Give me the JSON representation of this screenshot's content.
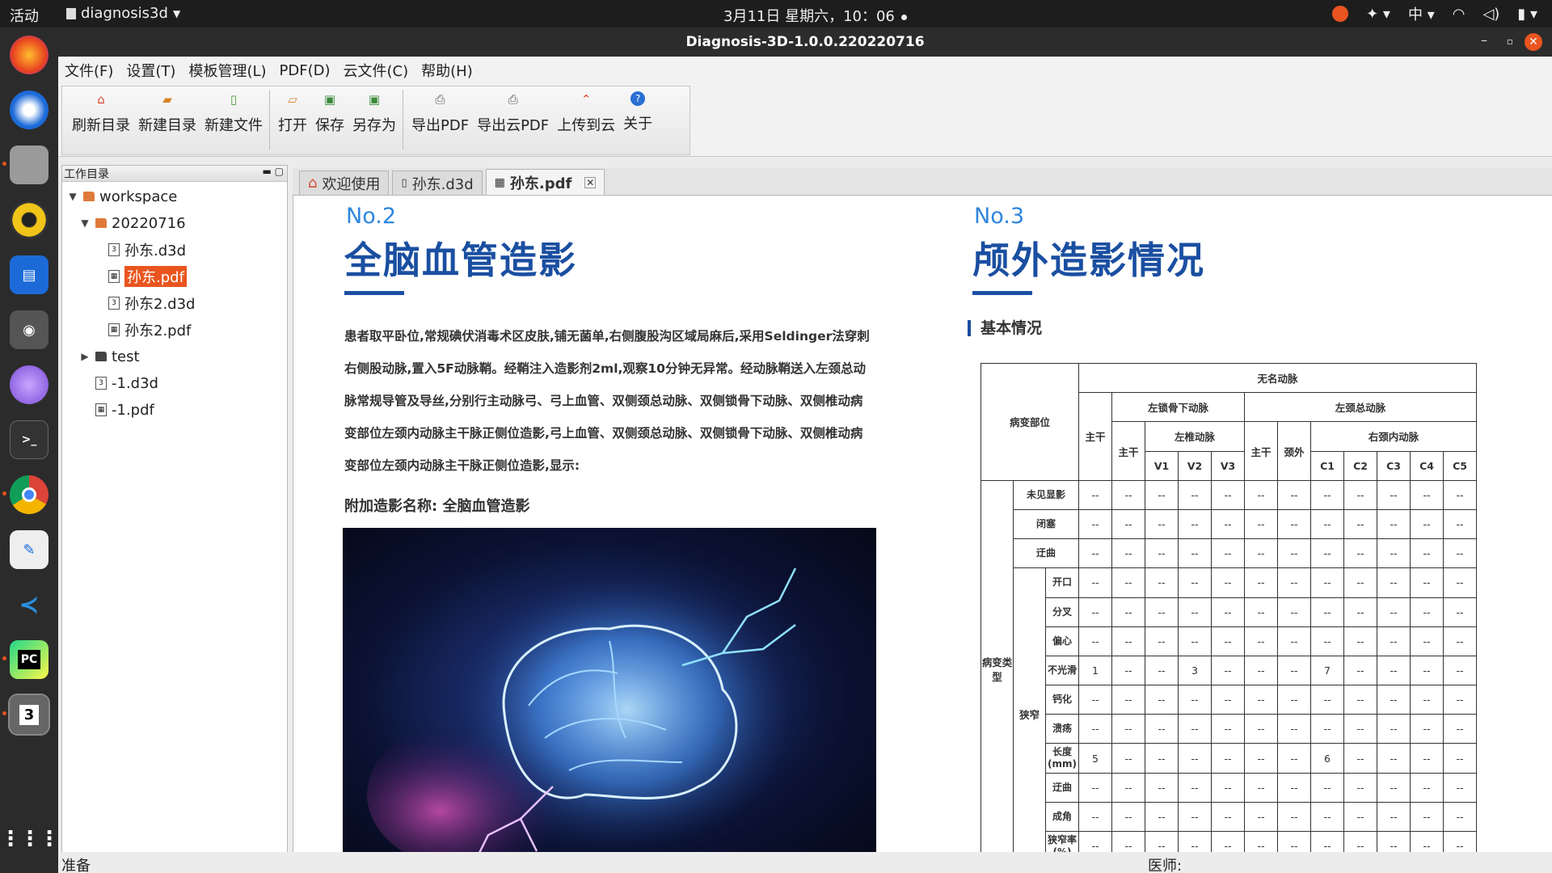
{
  "topbar": {
    "activities": "活动",
    "app_name": "diagnosis3d",
    "clock": "3月11日 星期六，10：06",
    "ime": "中"
  },
  "window": {
    "title": "Diagnosis-3D-1.0.0.220220716"
  },
  "menu": [
    "文件(F)",
    "设置(T)",
    "模板管理(L)",
    "PDF(D)",
    "云文件(C)",
    "帮助(H)"
  ],
  "toolbar": {
    "refresh": "刷新目录",
    "new_dir": "新建目录",
    "new_file": "新建文件",
    "open": "打开",
    "save": "保存",
    "save_as": "另存为",
    "export_pdf": "导出PDF",
    "export_cloud_pdf": "导出云PDF",
    "upload": "上传到云",
    "about": "关于"
  },
  "panel": {
    "title": "工作目录"
  },
  "tree": {
    "workspace": "workspace",
    "date_dir": "20220716",
    "f1": "孙东.d3d",
    "f2": "孙东.pdf",
    "f3": "孙东2.d3d",
    "f4": "孙东2.pdf",
    "test": "test",
    "f5": "-1.d3d",
    "f6": "-1.pdf"
  },
  "tabs": {
    "welcome": "欢迎使用",
    "d3d": "孙东.d3d",
    "pdf": "孙东.pdf"
  },
  "doc": {
    "no2": "No.2",
    "h2": "全脑血管造影",
    "para": "患者取平卧位,常规碘伏消毒术区皮肤,铺无菌单,右侧腹股沟区域局麻后,采用Seldinger法穿刺右侧股动脉,置入5F动脉鞘。经鞘注入造影剂2ml,观察10分钟无异常。经动脉鞘送入左颈总动脉常规导管及导丝,分别行主动脉弓、弓上血管、双侧颈总动脉、双侧锁骨下动脉、双侧椎动病变部位左颈内动脉主干脉正侧位造影,弓上血管、双侧颈总动脉、双侧锁骨下动脉、双侧椎动病变部位左颈内动脉主干脉正侧位造影,显示:",
    "sub": "附加造影名称: 全脑血管造影",
    "no3": "No.3",
    "h3": "颅外造影情况",
    "section": "基本情况"
  },
  "table": {
    "h_lesion_site": "病变部位",
    "h_innominate": "无名动脉",
    "h_main": "主干",
    "h_left_subclavian": "左锁骨下动脉",
    "h_left_carotid": "左颈总动脉",
    "h_left_vertebral": "左椎动脉",
    "h_extracranial": "颈外",
    "h_right_internal": "右颈内动脉",
    "segs": [
      "V1",
      "V2",
      "V3",
      "C1",
      "C2",
      "C3",
      "C4",
      "C5"
    ],
    "g_lesion_type": "病变类型",
    "g_stenosis": "狭窄",
    "rows": [
      {
        "label": "未见显影",
        "vals": [
          "--",
          "--",
          "--",
          "--",
          "--",
          "--",
          "--",
          "--",
          "--",
          "--",
          "--",
          "--"
        ]
      },
      {
        "label": "闭塞",
        "vals": [
          "--",
          "--",
          "--",
          "--",
          "--",
          "--",
          "--",
          "--",
          "--",
          "--",
          "--",
          "--"
        ]
      },
      {
        "label": "迂曲",
        "vals": [
          "--",
          "--",
          "--",
          "--",
          "--",
          "--",
          "--",
          "--",
          "--",
          "--",
          "--",
          "--"
        ]
      },
      {
        "label": "开口",
        "vals": [
          "--",
          "--",
          "--",
          "--",
          "--",
          "--",
          "--",
          "--",
          "--",
          "--",
          "--",
          "--"
        ]
      },
      {
        "label": "分叉",
        "vals": [
          "--",
          "--",
          "--",
          "--",
          "--",
          "--",
          "--",
          "--",
          "--",
          "--",
          "--",
          "--"
        ]
      },
      {
        "label": "偏心",
        "vals": [
          "--",
          "--",
          "--",
          "--",
          "--",
          "--",
          "--",
          "--",
          "--",
          "--",
          "--",
          "--"
        ]
      },
      {
        "label": "不光滑",
        "vals": [
          "1",
          "--",
          "--",
          "3",
          "--",
          "--",
          "--",
          "7",
          "--",
          "--",
          "--",
          "--"
        ]
      },
      {
        "label": "钙化",
        "vals": [
          "--",
          "--",
          "--",
          "--",
          "--",
          "--",
          "--",
          "--",
          "--",
          "--",
          "--",
          "--"
        ]
      },
      {
        "label": "溃疡",
        "vals": [
          "--",
          "--",
          "--",
          "--",
          "--",
          "--",
          "--",
          "--",
          "--",
          "--",
          "--",
          "--"
        ]
      },
      {
        "label": "长度(mm)",
        "vals": [
          "5",
          "--",
          "--",
          "--",
          "--",
          "--",
          "--",
          "6",
          "--",
          "--",
          "--",
          "--"
        ]
      },
      {
        "label": "迂曲",
        "vals": [
          "--",
          "--",
          "--",
          "--",
          "--",
          "--",
          "--",
          "--",
          "--",
          "--",
          "--",
          "--"
        ]
      },
      {
        "label": "成角",
        "vals": [
          "--",
          "--",
          "--",
          "--",
          "--",
          "--",
          "--",
          "--",
          "--",
          "--",
          "--",
          "--"
        ]
      },
      {
        "label": "狭窄率(%)",
        "vals": [
          "--",
          "--",
          "--",
          "--",
          "--",
          "--",
          "--",
          "--",
          "--",
          "--",
          "--",
          "--"
        ]
      }
    ]
  },
  "status": {
    "left": "准备",
    "right": "医师:"
  }
}
